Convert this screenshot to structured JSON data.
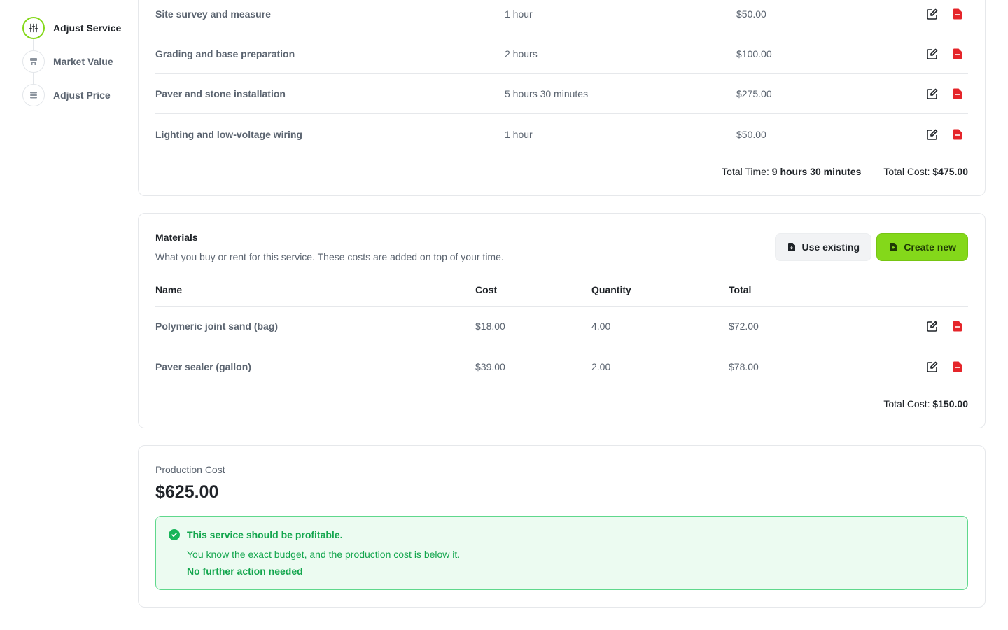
{
  "sidebar": {
    "steps": [
      {
        "label": "Adjust Service",
        "icon": "sliders-icon",
        "active": true
      },
      {
        "label": "Market Value",
        "icon": "store-icon",
        "active": false
      },
      {
        "label": "Adjust Price",
        "icon": "list-icon",
        "active": false
      }
    ]
  },
  "labor": {
    "rows": [
      {
        "name": "Site survey and measure",
        "time": "1 hour",
        "cost": "$50.00"
      },
      {
        "name": "Grading and base preparation",
        "time": "2 hours",
        "cost": "$100.00"
      },
      {
        "name": "Paver and stone installation",
        "time": "5 hours 30 minutes",
        "cost": "$275.00"
      },
      {
        "name": "Lighting and low-voltage wiring",
        "time": "1 hour",
        "cost": "$50.00"
      }
    ],
    "total_time_label": "Total Time:",
    "total_time_value": "9 hours 30 minutes",
    "total_cost_label": "Total Cost:",
    "total_cost_value": "$475.00"
  },
  "materials": {
    "title": "Materials",
    "description": "What you buy or rent for this service. These costs are added on top of your time.",
    "use_existing_label": "Use existing",
    "create_new_label": "Create new",
    "columns": [
      "Name",
      "Cost",
      "Quantity",
      "Total"
    ],
    "rows": [
      {
        "name": "Polymeric joint sand (bag)",
        "cost": "$18.00",
        "quantity": "4.00",
        "total": "$72.00"
      },
      {
        "name": "Paver sealer (gallon)",
        "cost": "$39.00",
        "quantity": "2.00",
        "total": "$78.00"
      }
    ],
    "total_cost_label": "Total Cost:",
    "total_cost_value": "$150.00"
  },
  "production": {
    "label": "Production Cost",
    "value": "$625.00",
    "alert": {
      "title": "This service should be profitable.",
      "text": "You know the exact budget, and the production cost is below it.",
      "action": "No further action needed"
    }
  },
  "colors": {
    "accent": "#84d81a",
    "danger": "#e5252a",
    "success": "#14a64e"
  }
}
